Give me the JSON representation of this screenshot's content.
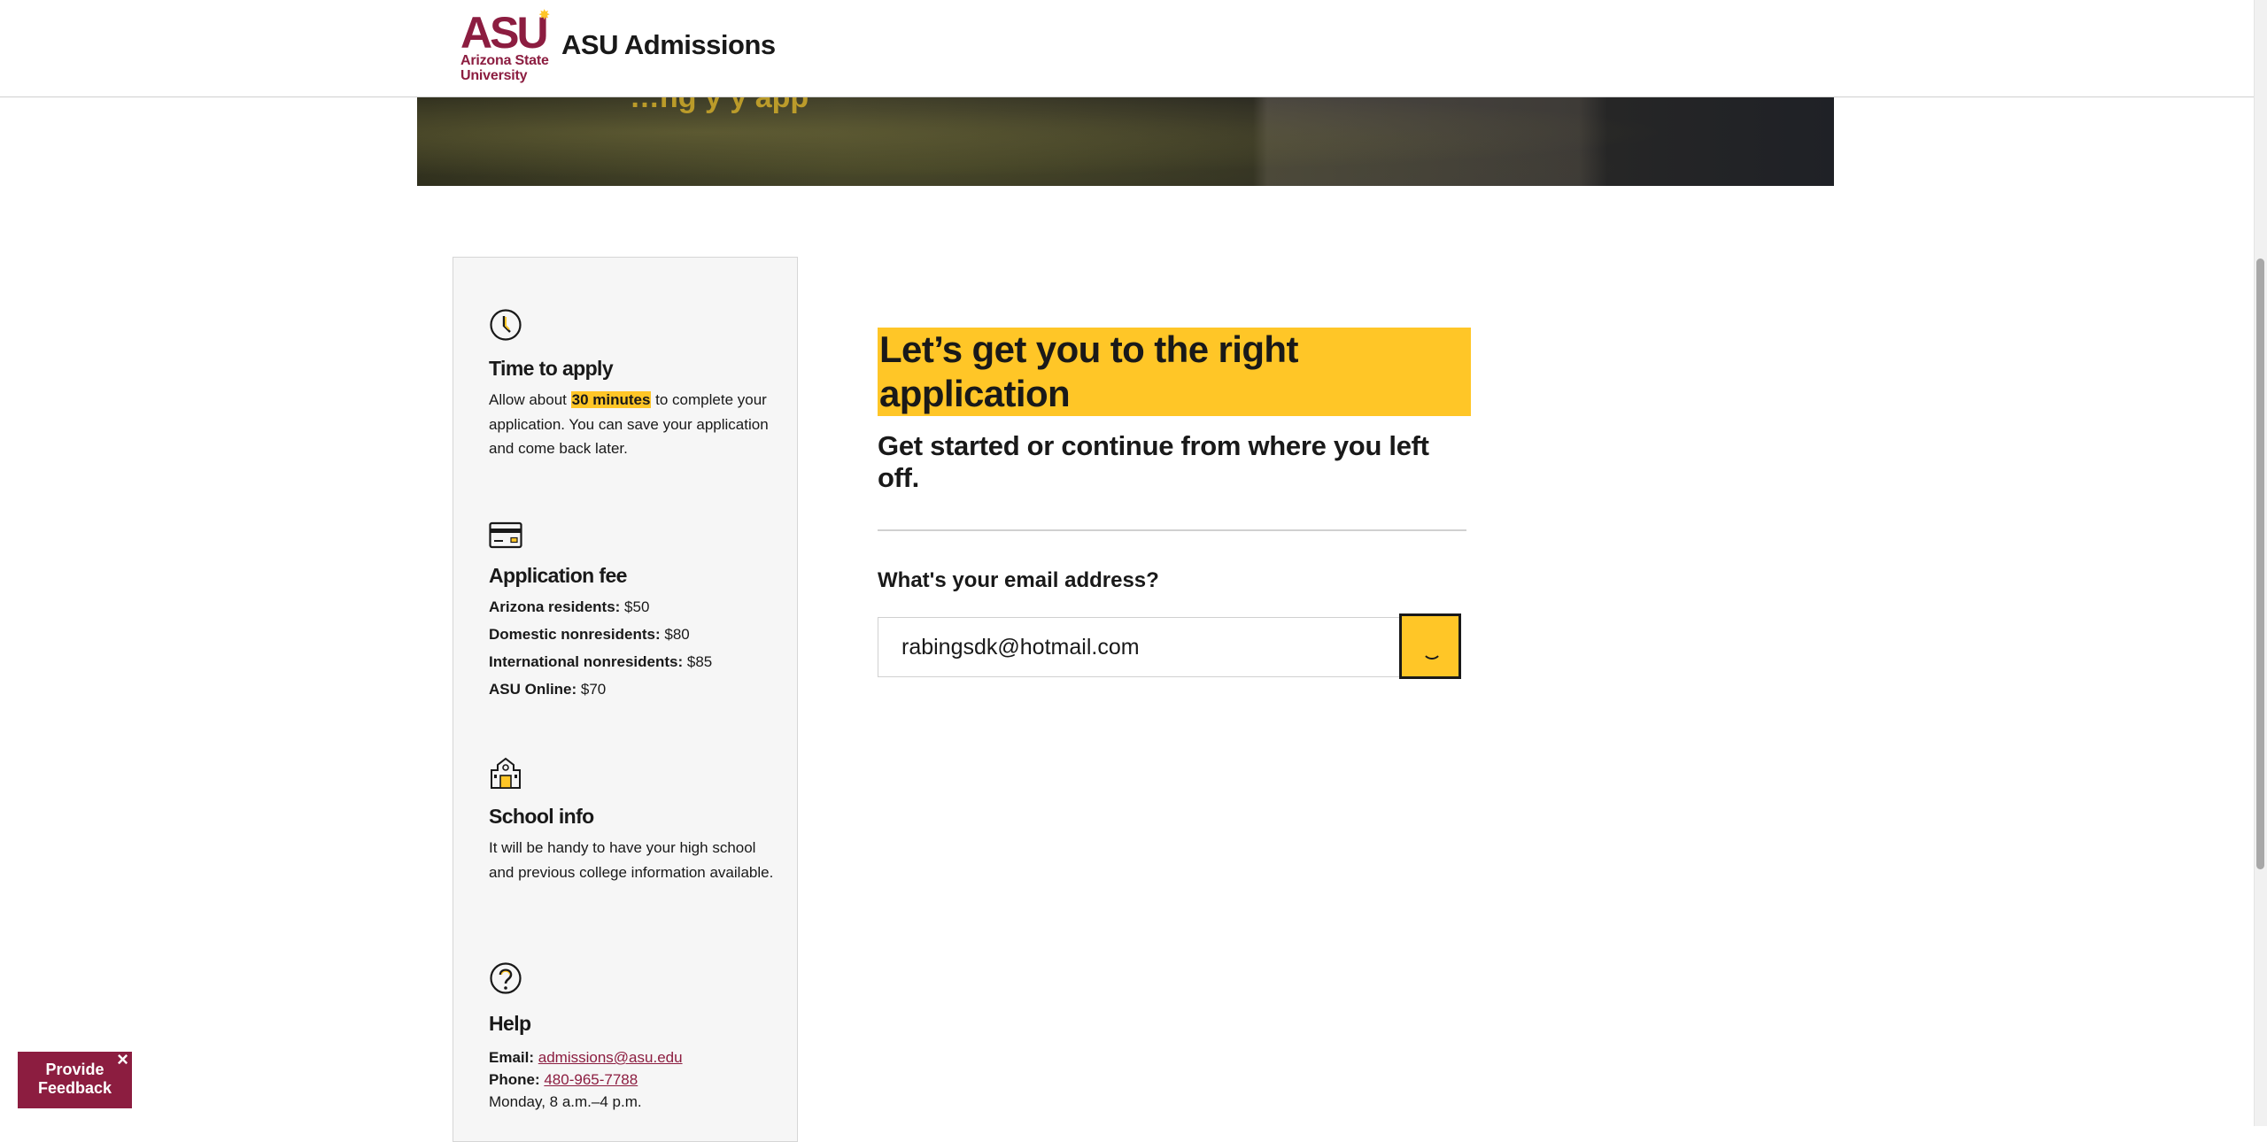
{
  "header": {
    "logo_mark": "ASU",
    "logo_text": "Arizona State\nUniversity",
    "title": "ASU Admissions"
  },
  "hero": {
    "partial_text": "…ng      y  y                app"
  },
  "sidebar": {
    "time": {
      "icon": "clock-icon",
      "title": "Time to apply",
      "text_before": "Allow about ",
      "highlight": "30 minutes",
      "text_after": " to complete your application. You can save your application and come back later."
    },
    "fee": {
      "icon": "credit-card-icon",
      "title": "Application fee",
      "rows": [
        {
          "label": "Arizona residents:",
          "value": " $50"
        },
        {
          "label": "Domestic nonresidents:",
          "value": " $80"
        },
        {
          "label": "International nonresidents:",
          "value": " $85"
        },
        {
          "label": "ASU Online:",
          "value": " $70"
        }
      ]
    },
    "school": {
      "icon": "school-building-icon",
      "title": "School info",
      "text": "It will be handy to have your high school and previous college information available."
    },
    "help": {
      "icon": "question-circle-icon",
      "title": "Help",
      "email_label": "Email:",
      "email": "admissions@asu.edu",
      "phone_label": "Phone:",
      "phone": "480-965-7788",
      "hours": "Monday, 8 a.m.–4 p.m."
    }
  },
  "main": {
    "headline": "Let’s get you to the right application",
    "subheadline": "Get started or continue from where you left off.",
    "email_label": "What's your email address?",
    "email_value": "rabingsdk@hotmail.com",
    "submit_icon": "loading-spinner-icon"
  },
  "feedback": {
    "label_line1": "Provide",
    "label_line2": "Feedback",
    "close": "×"
  },
  "colors": {
    "maroon": "#8c1d40",
    "gold": "#ffc627",
    "text": "#191919"
  }
}
